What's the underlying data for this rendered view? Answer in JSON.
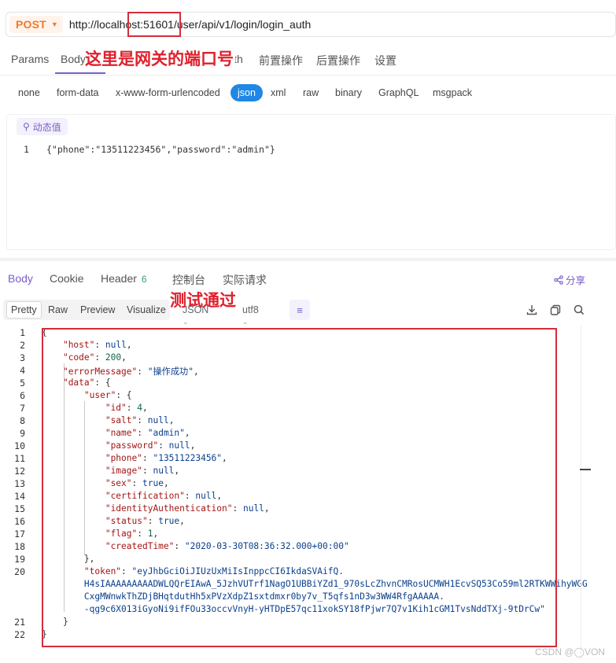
{
  "request": {
    "method": "POST",
    "url": "http://localhost:51601/user/api/v1/login/login_auth",
    "tabs": [
      "Params",
      "Body",
      "Auth",
      "前置操作",
      "后置操作",
      "设置"
    ],
    "active_tab": "Body",
    "annotation_port": "这里是网关的端口号",
    "body_types": [
      "none",
      "form-data",
      "x-www-form-urlencoded",
      "json",
      "xml",
      "raw",
      "binary",
      "GraphQL",
      "msgpack"
    ],
    "active_body_type": "json",
    "dynamic_value_label": "动态值",
    "body_line_no": "1",
    "body_line": "{\"phone\":\"13511223456\",\"password\":\"admin\"}"
  },
  "response": {
    "tabs": [
      "Body",
      "Cookie",
      "Header",
      "控制台",
      "实际请求"
    ],
    "header_count": "6",
    "share_label": "分享",
    "annotation_test": "测试通过",
    "formats": [
      "Pretty",
      "Raw",
      "Preview",
      "Visualize"
    ],
    "active_format": "Pretty",
    "lang_select": "JSON",
    "encoding_select": "utf8",
    "line_numbers": [
      "1",
      "2",
      "3",
      "4",
      "5",
      "6",
      "7",
      "8",
      "9",
      "10",
      "11",
      "12",
      "13",
      "14",
      "15",
      "16",
      "17",
      "18",
      "19",
      "20",
      "",
      "",
      "",
      "21",
      "22"
    ],
    "lines": [
      "{",
      "    \"host\": null,",
      "    \"code\": 200,",
      "    \"errorMessage\": \"操作成功\",",
      "    \"data\": {",
      "        \"user\": {",
      "            \"id\": 4,",
      "            \"salt\": null,",
      "            \"name\": \"admin\",",
      "            \"password\": null,",
      "            \"phone\": \"13511223456\",",
      "            \"image\": null,",
      "            \"sex\": true,",
      "            \"certification\": null,",
      "            \"identityAuthentication\": null,",
      "            \"status\": true,",
      "            \"flag\": 1,",
      "            \"createdTime\": \"2020-03-30T08:36:32.000+00:00\"",
      "        },",
      "        \"token\": \"eyJhbGciOiJIUzUxMiIsInppcCI6IkdaSVAifQ.",
      "        H4sIAAAAAAAAADWLQQrEIAwA_5JzhVUTrf1NagO1UBBiYZd1_970sLcZhvnCMRosUCMWH1EcvSQ53Co59ml2RTKWWihyWGG",
      "        CxgMWnwkThZDjBHqtdutHh5xPVzXdpZ1sxtdmxr0by7v_T5qfs1nD3w3WW4RfgAAAAA.",
      "        -qg9c6X013iGyoNi9ifFOu33occvVnyH-yHTDpE57qc11xokSY18fPjwr7Q7v1Kih1cGM1TvsNddTXj-9tDrCw\"",
      "    }",
      "}"
    ]
  },
  "watermark": "CSDN @◯VON"
}
